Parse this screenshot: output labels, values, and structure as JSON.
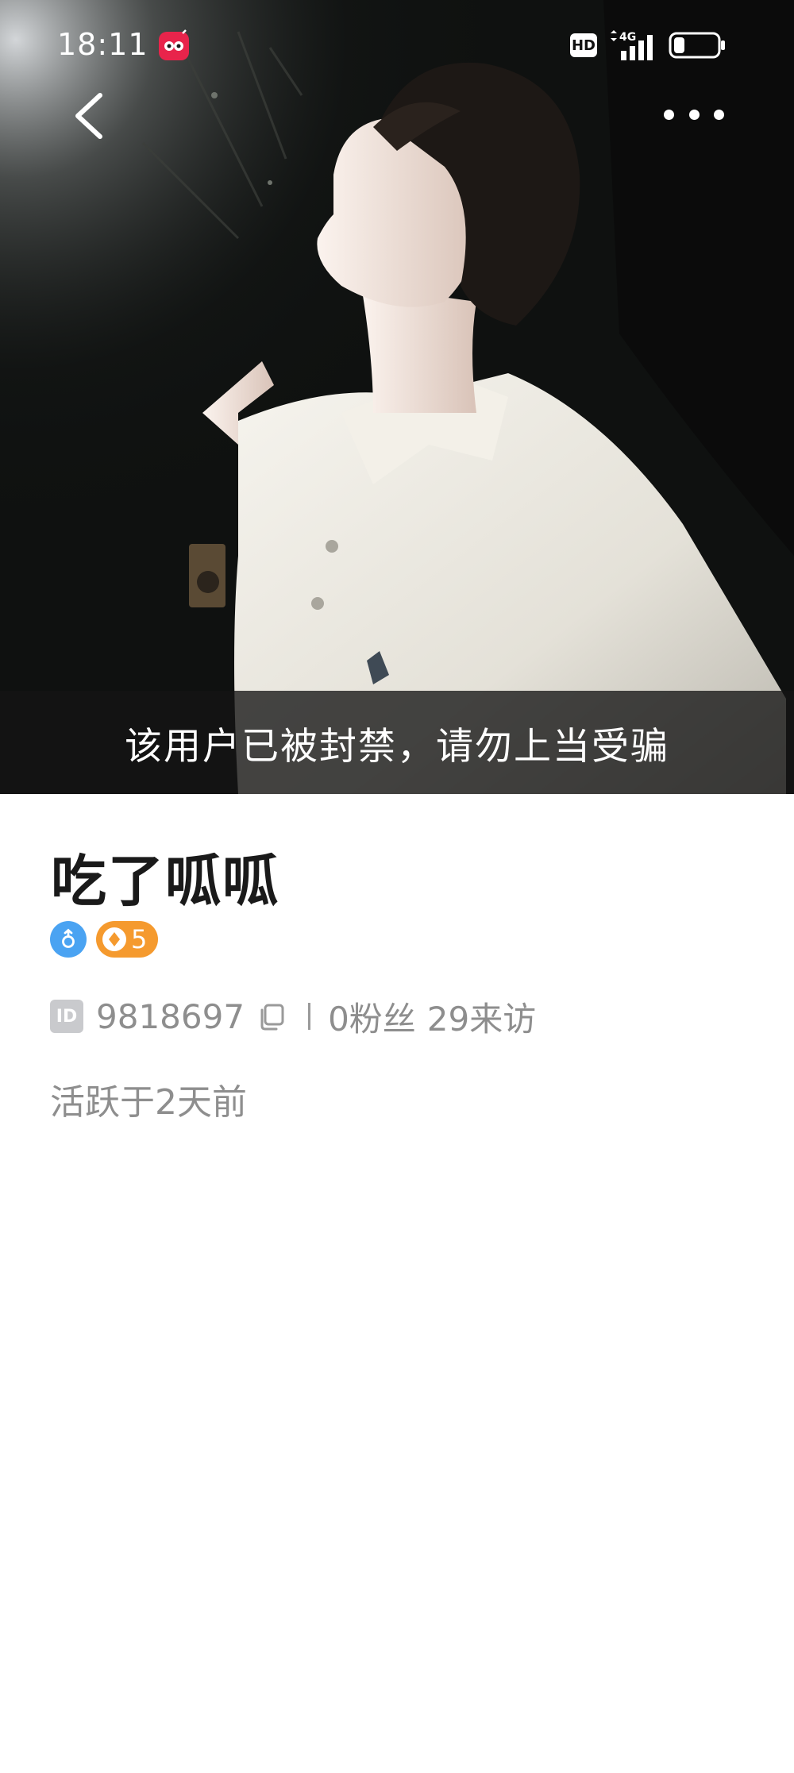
{
  "status_bar": {
    "time": "18:11",
    "hd_label": "HD",
    "network_label": "4G",
    "app_notification_icon": "red-app-icon",
    "battery_level": 0.25
  },
  "nav": {
    "back_icon": "chevron-left-icon",
    "more_icon": "more-dots-icon"
  },
  "cover": {
    "ban_notice": "该用户已被封禁，请勿上当受骗"
  },
  "profile": {
    "username": "吃了呱呱",
    "gender_icon": "male-icon",
    "level": "5",
    "id_label": "ID",
    "id_value": "9818697",
    "fans": "0粉丝",
    "visits": "29来访",
    "active_status": "活跃于2天前"
  },
  "colors": {
    "accent_gender": "#4aa3f2",
    "accent_level": "#f59a2e",
    "muted_text": "#8e8e8e"
  }
}
